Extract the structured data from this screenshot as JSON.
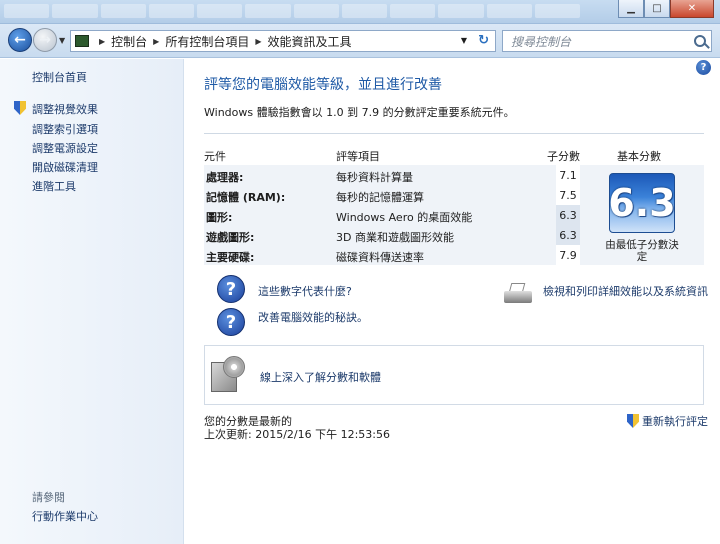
{
  "window": {
    "controls": {
      "minimize": "▁",
      "maximize": "□",
      "close": "✕"
    }
  },
  "address": {
    "breadcrumbs": [
      "控制台",
      "所有控制台項目",
      "效能資訊及工具"
    ],
    "search_placeholder": "搜尋控制台"
  },
  "sidebar": {
    "home": "控制台首頁",
    "items": [
      "調整視覺效果",
      "調整索引選項",
      "調整電源設定",
      "開啟磁碟清理",
      "進階工具"
    ],
    "see_also_heading": "請參閱",
    "see_also_items": [
      "行動作業中心"
    ]
  },
  "main": {
    "help_icon": "?",
    "title": "評等您的電腦效能等級，並且進行改善",
    "description": "Windows 體驗指數會以 1.0 到 7.9 的分數評定重要系統元件。",
    "table": {
      "headers": {
        "component": "元件",
        "rated": "評等項目",
        "subscore": "子分數",
        "basescore": "基本分數"
      },
      "rows": [
        {
          "component": "處理器:",
          "rated": "每秒資料計算量",
          "score": "7.1"
        },
        {
          "component": "記憶體 (RAM):",
          "rated": "每秒的記憶體運算",
          "score": "7.5"
        },
        {
          "component": "圖形:",
          "rated": "Windows Aero 的桌面效能",
          "score": "6.3"
        },
        {
          "component": "遊戲圖形:",
          "rated": "3D 商業和遊戲圖形效能",
          "score": "6.3"
        },
        {
          "component": "主要硬碟:",
          "rated": "磁碟資料傳送速率",
          "score": "7.9"
        }
      ],
      "base_score": "6.3",
      "base_caption": "由最低子分數決定"
    },
    "links": {
      "what_numbers": "這些數字代表什麼?",
      "print_details": "檢視和列印詳細效能以及系統資訊",
      "tips": "改善電腦效能的秘訣。",
      "online": "線上深入了解分數和軟體"
    },
    "status": {
      "current": "您的分數是最新的",
      "last_update": "上次更新: 2015/2/16 下午 12:53:56",
      "rerun": "重新執行評定"
    }
  }
}
